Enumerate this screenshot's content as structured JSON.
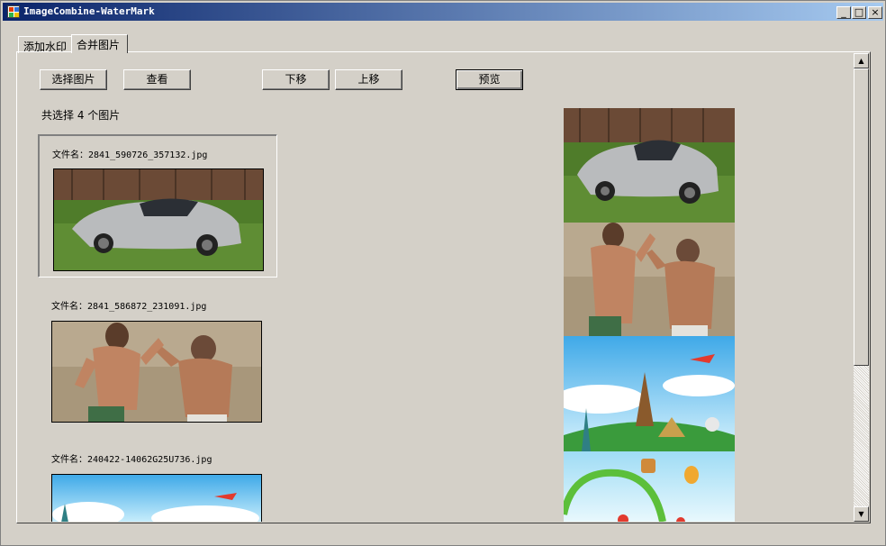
{
  "window": {
    "title": "ImageCombine-WaterMark",
    "minimize": "_",
    "maximize": "□",
    "close": "×"
  },
  "tabs": [
    {
      "label": "添加水印",
      "active": false
    },
    {
      "label": "合并图片",
      "active": true
    }
  ],
  "toolbar": {
    "select_label": "选择图片",
    "view_label": "查看",
    "move_down_label": "下移",
    "move_up_label": "上移",
    "preview_label": "预览"
  },
  "summary": "共选择 4 个图片",
  "files": [
    {
      "caption": "文件名：2841_590726_357132.jpg",
      "image": "silver-sports-car"
    },
    {
      "caption": "文件名：2841_586872_231091.jpg",
      "image": "two-boxers"
    },
    {
      "caption": "文件名：240422-14062G25U736.jpg",
      "image": "world-landmarks-cartoon"
    }
  ],
  "preview": {
    "images": [
      "silver-sports-car",
      "two-boxers",
      "world-landmarks-cartoon",
      "cartoon-park-balloons"
    ]
  },
  "colors": {
    "titlebar_start": "#0a246a",
    "titlebar_end": "#a6caf0",
    "face": "#d4d0c8"
  }
}
